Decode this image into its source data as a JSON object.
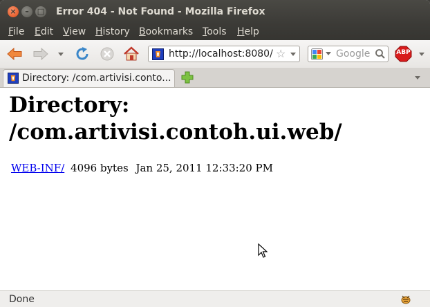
{
  "window": {
    "title": "Error 404 - Not Found - Mozilla Firefox",
    "controls": [
      "×",
      "–",
      "□"
    ]
  },
  "menu": [
    "File",
    "Edit",
    "View",
    "History",
    "Bookmarks",
    "Tools",
    "Help"
  ],
  "toolbar": {
    "url": "http://localhost:8080/",
    "search_placeholder": "Google",
    "adblock_label": "ABP"
  },
  "tabs": [
    {
      "title": "Directory: /com.artivisi.conto..."
    }
  ],
  "page": {
    "heading": "Directory: /com.artivisi.contoh.ui.web/",
    "entries": [
      {
        "name": "WEB-INF/",
        "size": "4096 bytes",
        "modified": "Jan 25, 2011 12:33:20 PM"
      }
    ]
  },
  "status": {
    "text": "Done"
  },
  "colors": {
    "titlebar": "#3c3b37",
    "link": "#0000ee",
    "close_button": "#df4a16"
  }
}
